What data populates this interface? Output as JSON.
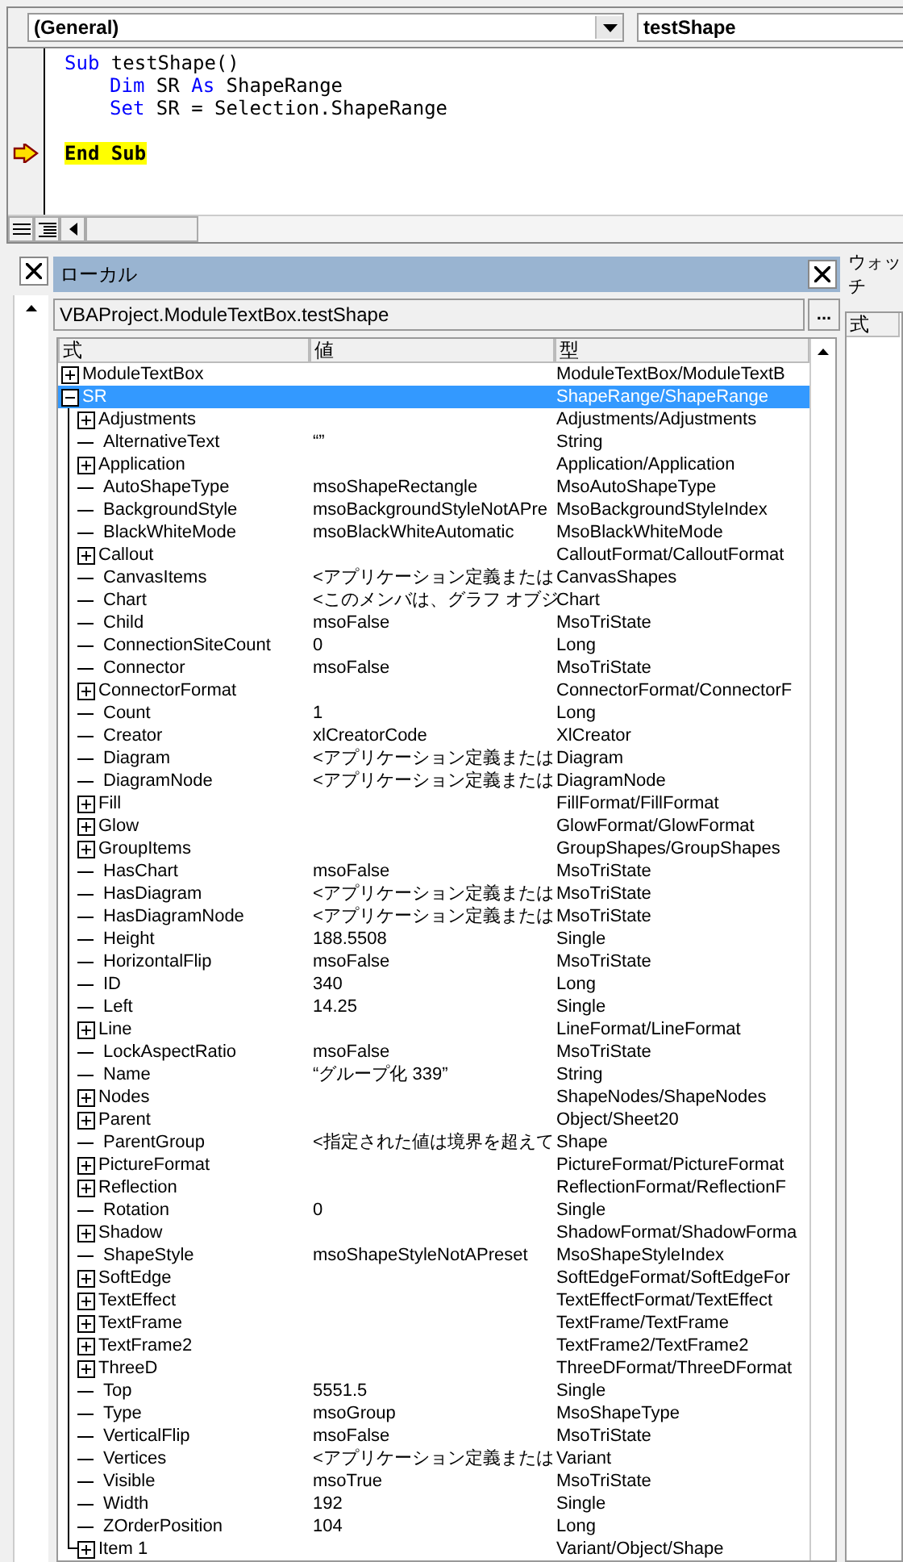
{
  "code_window": {
    "object_box": "(General)",
    "procedure_box": "testShape",
    "lines": [
      {
        "indent": false,
        "current": false,
        "tokens": [
          {
            "text": "Sub",
            "kind": "keyword"
          },
          {
            "text": " testShape()",
            "kind": "plain"
          }
        ]
      },
      {
        "indent": true,
        "current": false,
        "tokens": [
          {
            "text": "Dim",
            "kind": "keyword"
          },
          {
            "text": " SR ",
            "kind": "plain"
          },
          {
            "text": "As",
            "kind": "keyword"
          },
          {
            "text": " ShapeRange",
            "kind": "plain"
          }
        ]
      },
      {
        "indent": true,
        "current": false,
        "tokens": [
          {
            "text": "Set",
            "kind": "keyword"
          },
          {
            "text": " SR = Selection.ShapeRange",
            "kind": "plain"
          }
        ]
      },
      {
        "indent": false,
        "current": true,
        "tokens": [
          {
            "text": "End Sub",
            "kind": "keyword"
          }
        ]
      }
    ]
  },
  "locals": {
    "title": "ローカル",
    "context": "VBAProject.ModuleTextBox.testShape",
    "context_button": "...",
    "columns": [
      "式",
      "値",
      "型"
    ],
    "rows": [
      {
        "name": "ModuleTextBox",
        "value": "",
        "type": "ModuleTextBox/ModuleTextB",
        "kind": "object",
        "expanded": false,
        "selected": false
      },
      {
        "name": "SR",
        "value": "",
        "type": "ShapeRange/ShapeRange",
        "kind": "object",
        "expanded": true,
        "selected": true,
        "children": [
          {
            "name": "Adjustments",
            "type": "Adjustments/Adjustments",
            "kind": "object",
            "expanded": false,
            "selected": false
          },
          {
            "name": "AlternativeText",
            "value": "“”",
            "type": "String",
            "kind": "value",
            "selected": false
          },
          {
            "name": "Application",
            "type": "Application/Application",
            "kind": "object",
            "expanded": false,
            "selected": false
          },
          {
            "name": "AutoShapeType",
            "value": "msoShapeRectangle",
            "type": "MsoAutoShapeType",
            "kind": "value",
            "selected": false
          },
          {
            "name": "BackgroundStyle",
            "value": "msoBackgroundStyleNotAPre",
            "type": "MsoBackgroundStyleIndex",
            "kind": "value",
            "selected": false
          },
          {
            "name": "BlackWhiteMode",
            "value": "msoBlackWhiteAutomatic",
            "type": "MsoBlackWhiteMode",
            "kind": "value",
            "selected": false
          },
          {
            "name": "Callout",
            "type": "CalloutFormat/CalloutFormat",
            "kind": "object",
            "expanded": false,
            "selected": false
          },
          {
            "name": "CanvasItems",
            "value": "<アプリケーション定義または",
            "type": "CanvasShapes",
            "kind": "value",
            "selected": false
          },
          {
            "name": "Chart",
            "value": "<このメンバは、グラフ オブジ",
            "type": "Chart",
            "kind": "value",
            "selected": false
          },
          {
            "name": "Child",
            "value": "msoFalse",
            "type": "MsoTriState",
            "kind": "value",
            "selected": false
          },
          {
            "name": "ConnectionSiteCount",
            "value": "0",
            "type": "Long",
            "kind": "value",
            "selected": false
          },
          {
            "name": "Connector",
            "value": "msoFalse",
            "type": "MsoTriState",
            "kind": "value",
            "selected": false
          },
          {
            "name": "ConnectorFormat",
            "type": "ConnectorFormat/ConnectorF",
            "kind": "object",
            "expanded": false,
            "selected": false
          },
          {
            "name": "Count",
            "value": "1",
            "type": "Long",
            "kind": "value",
            "selected": false
          },
          {
            "name": "Creator",
            "value": "xlCreatorCode",
            "type": "XlCreator",
            "kind": "value",
            "selected": false
          },
          {
            "name": "Diagram",
            "value": "<アプリケーション定義または",
            "type": "Diagram",
            "kind": "value",
            "selected": false
          },
          {
            "name": "DiagramNode",
            "value": "<アプリケーション定義または",
            "type": "DiagramNode",
            "kind": "value",
            "selected": false
          },
          {
            "name": "Fill",
            "type": "FillFormat/FillFormat",
            "kind": "object",
            "expanded": false,
            "selected": false
          },
          {
            "name": "Glow",
            "type": "GlowFormat/GlowFormat",
            "kind": "object",
            "expanded": false,
            "selected": false
          },
          {
            "name": "GroupItems",
            "type": "GroupShapes/GroupShapes",
            "kind": "object",
            "expanded": false,
            "selected": false
          },
          {
            "name": "HasChart",
            "value": "msoFalse",
            "type": "MsoTriState",
            "kind": "value",
            "selected": false
          },
          {
            "name": "HasDiagram",
            "value": "<アプリケーション定義または",
            "type": "MsoTriState",
            "kind": "value",
            "selected": false
          },
          {
            "name": "HasDiagramNode",
            "value": "<アプリケーション定義または",
            "type": "MsoTriState",
            "kind": "value",
            "selected": false
          },
          {
            "name": "Height",
            "value": "188.5508",
            "type": "Single",
            "kind": "value",
            "selected": false
          },
          {
            "name": "HorizontalFlip",
            "value": "msoFalse",
            "type": "MsoTriState",
            "kind": "value",
            "selected": false
          },
          {
            "name": "ID",
            "value": "340",
            "type": "Long",
            "kind": "value",
            "selected": false
          },
          {
            "name": "Left",
            "value": "14.25",
            "type": "Single",
            "kind": "value",
            "selected": false
          },
          {
            "name": "Line",
            "type": "LineFormat/LineFormat",
            "kind": "object",
            "expanded": false,
            "selected": false
          },
          {
            "name": "LockAspectRatio",
            "value": "msoFalse",
            "type": "MsoTriState",
            "kind": "value",
            "selected": false
          },
          {
            "name": "Name",
            "value": "“グループ化 339”",
            "type": "String",
            "kind": "value",
            "selected": false
          },
          {
            "name": "Nodes",
            "type": "ShapeNodes/ShapeNodes",
            "kind": "object",
            "expanded": false,
            "selected": false
          },
          {
            "name": "Parent",
            "type": "Object/Sheet20",
            "kind": "object",
            "expanded": false,
            "selected": false
          },
          {
            "name": "ParentGroup",
            "value": "<指定された値は境界を超えて",
            "type": "Shape",
            "kind": "value",
            "selected": false
          },
          {
            "name": "PictureFormat",
            "type": "PictureFormat/PictureFormat",
            "kind": "object",
            "expanded": false,
            "selected": false
          },
          {
            "name": "Reflection",
            "type": "ReflectionFormat/ReflectionF",
            "kind": "object",
            "expanded": false,
            "selected": false
          },
          {
            "name": "Rotation",
            "value": "0",
            "type": "Single",
            "kind": "value",
            "selected": false
          },
          {
            "name": "Shadow",
            "type": "ShadowFormat/ShadowForma",
            "kind": "object",
            "expanded": false,
            "selected": false
          },
          {
            "name": "ShapeStyle",
            "value": "msoShapeStyleNotAPreset",
            "type": "MsoShapeStyleIndex",
            "kind": "value",
            "selected": false
          },
          {
            "name": "SoftEdge",
            "type": "SoftEdgeFormat/SoftEdgeFor",
            "kind": "object",
            "expanded": false,
            "selected": false
          },
          {
            "name": "TextEffect",
            "type": "TextEffectFormat/TextEffect",
            "kind": "object",
            "expanded": false,
            "selected": false
          },
          {
            "name": "TextFrame",
            "type": "TextFrame/TextFrame",
            "kind": "object",
            "expanded": false,
            "selected": false
          },
          {
            "name": "TextFrame2",
            "type": "TextFrame2/TextFrame2",
            "kind": "object",
            "expanded": false,
            "selected": false
          },
          {
            "name": "ThreeD",
            "type": "ThreeDFormat/ThreeDFormat",
            "kind": "object",
            "expanded": false,
            "selected": false
          },
          {
            "name": "Top",
            "value": "5551.5",
            "type": "Single",
            "kind": "value",
            "selected": false
          },
          {
            "name": "Type",
            "value": "msoGroup",
            "type": "MsoShapeType",
            "kind": "value",
            "selected": false
          },
          {
            "name": "VerticalFlip",
            "value": "msoFalse",
            "type": "MsoTriState",
            "kind": "value",
            "selected": false
          },
          {
            "name": "Vertices",
            "value": "<アプリケーション定義または",
            "type": "Variant",
            "kind": "value",
            "selected": false
          },
          {
            "name": "Visible",
            "value": "msoTrue",
            "type": "MsoTriState",
            "kind": "value",
            "selected": false
          },
          {
            "name": "Width",
            "value": "192",
            "type": "Single",
            "kind": "value",
            "selected": false
          },
          {
            "name": "ZOrderPosition",
            "value": "104",
            "type": "Long",
            "kind": "value",
            "selected": false
          },
          {
            "name": "Item 1",
            "type": "Variant/Object/Shape",
            "kind": "object",
            "expanded": false,
            "selected": false
          }
        ]
      }
    ]
  },
  "watch": {
    "title": "ウォッチ",
    "column": "式"
  }
}
